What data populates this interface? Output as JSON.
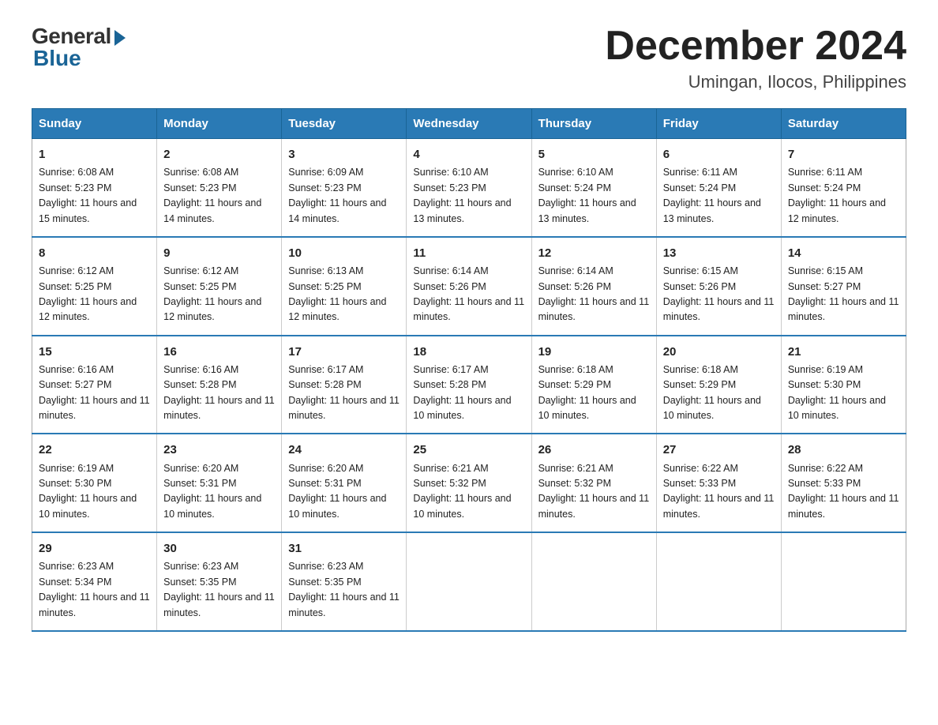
{
  "header": {
    "logo_general": "General",
    "logo_blue": "Blue",
    "month_title": "December 2024",
    "location": "Umingan, Ilocos, Philippines"
  },
  "days_of_week": [
    "Sunday",
    "Monday",
    "Tuesday",
    "Wednesday",
    "Thursday",
    "Friday",
    "Saturday"
  ],
  "weeks": [
    [
      {
        "day": "1",
        "sunrise": "Sunrise: 6:08 AM",
        "sunset": "Sunset: 5:23 PM",
        "daylight": "Daylight: 11 hours and 15 minutes."
      },
      {
        "day": "2",
        "sunrise": "Sunrise: 6:08 AM",
        "sunset": "Sunset: 5:23 PM",
        "daylight": "Daylight: 11 hours and 14 minutes."
      },
      {
        "day": "3",
        "sunrise": "Sunrise: 6:09 AM",
        "sunset": "Sunset: 5:23 PM",
        "daylight": "Daylight: 11 hours and 14 minutes."
      },
      {
        "day": "4",
        "sunrise": "Sunrise: 6:10 AM",
        "sunset": "Sunset: 5:23 PM",
        "daylight": "Daylight: 11 hours and 13 minutes."
      },
      {
        "day": "5",
        "sunrise": "Sunrise: 6:10 AM",
        "sunset": "Sunset: 5:24 PM",
        "daylight": "Daylight: 11 hours and 13 minutes."
      },
      {
        "day": "6",
        "sunrise": "Sunrise: 6:11 AM",
        "sunset": "Sunset: 5:24 PM",
        "daylight": "Daylight: 11 hours and 13 minutes."
      },
      {
        "day": "7",
        "sunrise": "Sunrise: 6:11 AM",
        "sunset": "Sunset: 5:24 PM",
        "daylight": "Daylight: 11 hours and 12 minutes."
      }
    ],
    [
      {
        "day": "8",
        "sunrise": "Sunrise: 6:12 AM",
        "sunset": "Sunset: 5:25 PM",
        "daylight": "Daylight: 11 hours and 12 minutes."
      },
      {
        "day": "9",
        "sunrise": "Sunrise: 6:12 AM",
        "sunset": "Sunset: 5:25 PM",
        "daylight": "Daylight: 11 hours and 12 minutes."
      },
      {
        "day": "10",
        "sunrise": "Sunrise: 6:13 AM",
        "sunset": "Sunset: 5:25 PM",
        "daylight": "Daylight: 11 hours and 12 minutes."
      },
      {
        "day": "11",
        "sunrise": "Sunrise: 6:14 AM",
        "sunset": "Sunset: 5:26 PM",
        "daylight": "Daylight: 11 hours and 11 minutes."
      },
      {
        "day": "12",
        "sunrise": "Sunrise: 6:14 AM",
        "sunset": "Sunset: 5:26 PM",
        "daylight": "Daylight: 11 hours and 11 minutes."
      },
      {
        "day": "13",
        "sunrise": "Sunrise: 6:15 AM",
        "sunset": "Sunset: 5:26 PM",
        "daylight": "Daylight: 11 hours and 11 minutes."
      },
      {
        "day": "14",
        "sunrise": "Sunrise: 6:15 AM",
        "sunset": "Sunset: 5:27 PM",
        "daylight": "Daylight: 11 hours and 11 minutes."
      }
    ],
    [
      {
        "day": "15",
        "sunrise": "Sunrise: 6:16 AM",
        "sunset": "Sunset: 5:27 PM",
        "daylight": "Daylight: 11 hours and 11 minutes."
      },
      {
        "day": "16",
        "sunrise": "Sunrise: 6:16 AM",
        "sunset": "Sunset: 5:28 PM",
        "daylight": "Daylight: 11 hours and 11 minutes."
      },
      {
        "day": "17",
        "sunrise": "Sunrise: 6:17 AM",
        "sunset": "Sunset: 5:28 PM",
        "daylight": "Daylight: 11 hours and 11 minutes."
      },
      {
        "day": "18",
        "sunrise": "Sunrise: 6:17 AM",
        "sunset": "Sunset: 5:28 PM",
        "daylight": "Daylight: 11 hours and 10 minutes."
      },
      {
        "day": "19",
        "sunrise": "Sunrise: 6:18 AM",
        "sunset": "Sunset: 5:29 PM",
        "daylight": "Daylight: 11 hours and 10 minutes."
      },
      {
        "day": "20",
        "sunrise": "Sunrise: 6:18 AM",
        "sunset": "Sunset: 5:29 PM",
        "daylight": "Daylight: 11 hours and 10 minutes."
      },
      {
        "day": "21",
        "sunrise": "Sunrise: 6:19 AM",
        "sunset": "Sunset: 5:30 PM",
        "daylight": "Daylight: 11 hours and 10 minutes."
      }
    ],
    [
      {
        "day": "22",
        "sunrise": "Sunrise: 6:19 AM",
        "sunset": "Sunset: 5:30 PM",
        "daylight": "Daylight: 11 hours and 10 minutes."
      },
      {
        "day": "23",
        "sunrise": "Sunrise: 6:20 AM",
        "sunset": "Sunset: 5:31 PM",
        "daylight": "Daylight: 11 hours and 10 minutes."
      },
      {
        "day": "24",
        "sunrise": "Sunrise: 6:20 AM",
        "sunset": "Sunset: 5:31 PM",
        "daylight": "Daylight: 11 hours and 10 minutes."
      },
      {
        "day": "25",
        "sunrise": "Sunrise: 6:21 AM",
        "sunset": "Sunset: 5:32 PM",
        "daylight": "Daylight: 11 hours and 10 minutes."
      },
      {
        "day": "26",
        "sunrise": "Sunrise: 6:21 AM",
        "sunset": "Sunset: 5:32 PM",
        "daylight": "Daylight: 11 hours and 11 minutes."
      },
      {
        "day": "27",
        "sunrise": "Sunrise: 6:22 AM",
        "sunset": "Sunset: 5:33 PM",
        "daylight": "Daylight: 11 hours and 11 minutes."
      },
      {
        "day": "28",
        "sunrise": "Sunrise: 6:22 AM",
        "sunset": "Sunset: 5:33 PM",
        "daylight": "Daylight: 11 hours and 11 minutes."
      }
    ],
    [
      {
        "day": "29",
        "sunrise": "Sunrise: 6:23 AM",
        "sunset": "Sunset: 5:34 PM",
        "daylight": "Daylight: 11 hours and 11 minutes."
      },
      {
        "day": "30",
        "sunrise": "Sunrise: 6:23 AM",
        "sunset": "Sunset: 5:35 PM",
        "daylight": "Daylight: 11 hours and 11 minutes."
      },
      {
        "day": "31",
        "sunrise": "Sunrise: 6:23 AM",
        "sunset": "Sunset: 5:35 PM",
        "daylight": "Daylight: 11 hours and 11 minutes."
      },
      {
        "day": "",
        "sunrise": "",
        "sunset": "",
        "daylight": ""
      },
      {
        "day": "",
        "sunrise": "",
        "sunset": "",
        "daylight": ""
      },
      {
        "day": "",
        "sunrise": "",
        "sunset": "",
        "daylight": ""
      },
      {
        "day": "",
        "sunrise": "",
        "sunset": "",
        "daylight": ""
      }
    ]
  ]
}
